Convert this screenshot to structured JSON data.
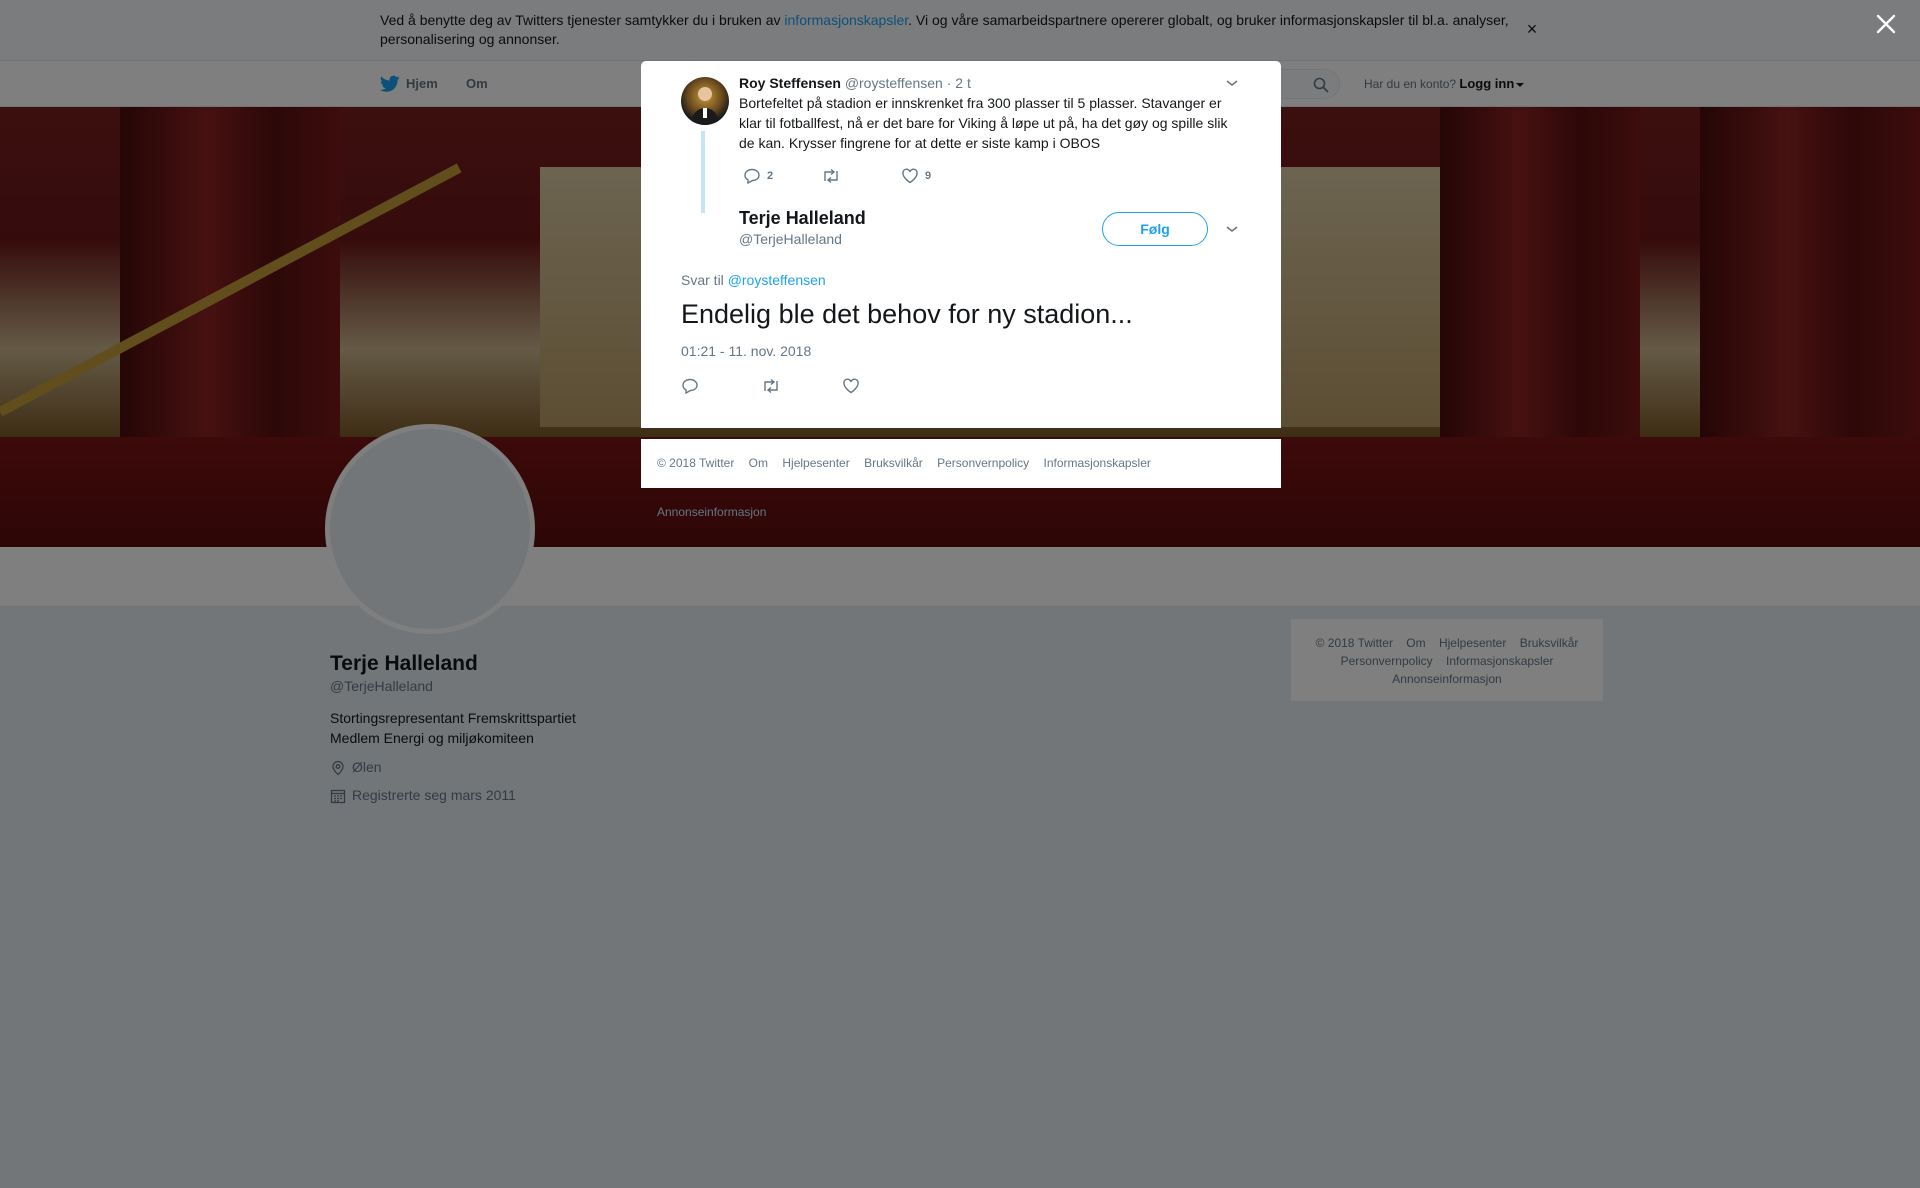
{
  "cookie_bar": {
    "text_before": "Ved å benytte deg av Twitters tjenester samtykker du i bruken av ",
    "link": "informasjonskapsler",
    "text_after": ". Vi og våre samarbeidspartnere opererer globalt, og bruker informasjonskapsler til bl.a. analyser, personalisering og annonser.",
    "close": "×"
  },
  "nav": {
    "home": "Hjem",
    "about": "Om",
    "account_prompt": "Har du en konto?",
    "login": "Logg inn"
  },
  "profile": {
    "name": "Terje Halleland",
    "handle": "@TerjeHalleland",
    "bio": "Stortingsrepresentant Fremskrittspartiet\nMedlem Energi og miljøkomiteen",
    "location": "Ølen",
    "joined": "Registrerte seg mars 2011"
  },
  "side_footer": [
    "© 2018 Twitter",
    "Om",
    "Hjelpesenter",
    "Bruksvilkår",
    "Personvernpolicy",
    "Informasjonskapsler",
    "Annonseinformasjon"
  ],
  "modal": {
    "parent": {
      "name": "Roy Steffensen",
      "handle": "@roysteffensen",
      "separator": "·",
      "time": "2 t",
      "text": "Bortefeltet på stadion er innskrenket fra 300 plasser til 5 plasser. Stavanger er klar til fotballfest, nå er det bare for Viking å løpe ut på, ha det gøy og spille slik de kan. Krysser fingrene for at dette er siste kamp i OBOS",
      "replies": "2",
      "retweets": "",
      "likes": "9"
    },
    "tweet": {
      "name": "Terje Halleland",
      "handle": "@TerjeHalleland",
      "follow": "Følg",
      "reply_prefix": "Svar til ",
      "reply_target": "@roysteffensen",
      "text": "Endelig ble det behov for ny stadion...",
      "timestamp": "01:21 - 11. nov. 2018"
    },
    "footer": [
      "© 2018 Twitter",
      "Om",
      "Hjelpesenter",
      "Bruksvilkår",
      "Personvernpolicy",
      "Informasjonskapsler",
      "Annonseinformasjon"
    ]
  },
  "icons": {
    "twitter": "twitter-bird-icon",
    "search": "search-icon",
    "close": "close-icon",
    "reply": "reply-icon",
    "retweet": "retweet-icon",
    "like": "heart-icon",
    "location": "location-pin-icon",
    "calendar": "calendar-icon",
    "caret": "chevron-down-icon"
  },
  "colors": {
    "accent": "#1da1f2",
    "thread_line": "#c4e5f8",
    "overlay": "rgba(0,0,0,0.5)"
  }
}
